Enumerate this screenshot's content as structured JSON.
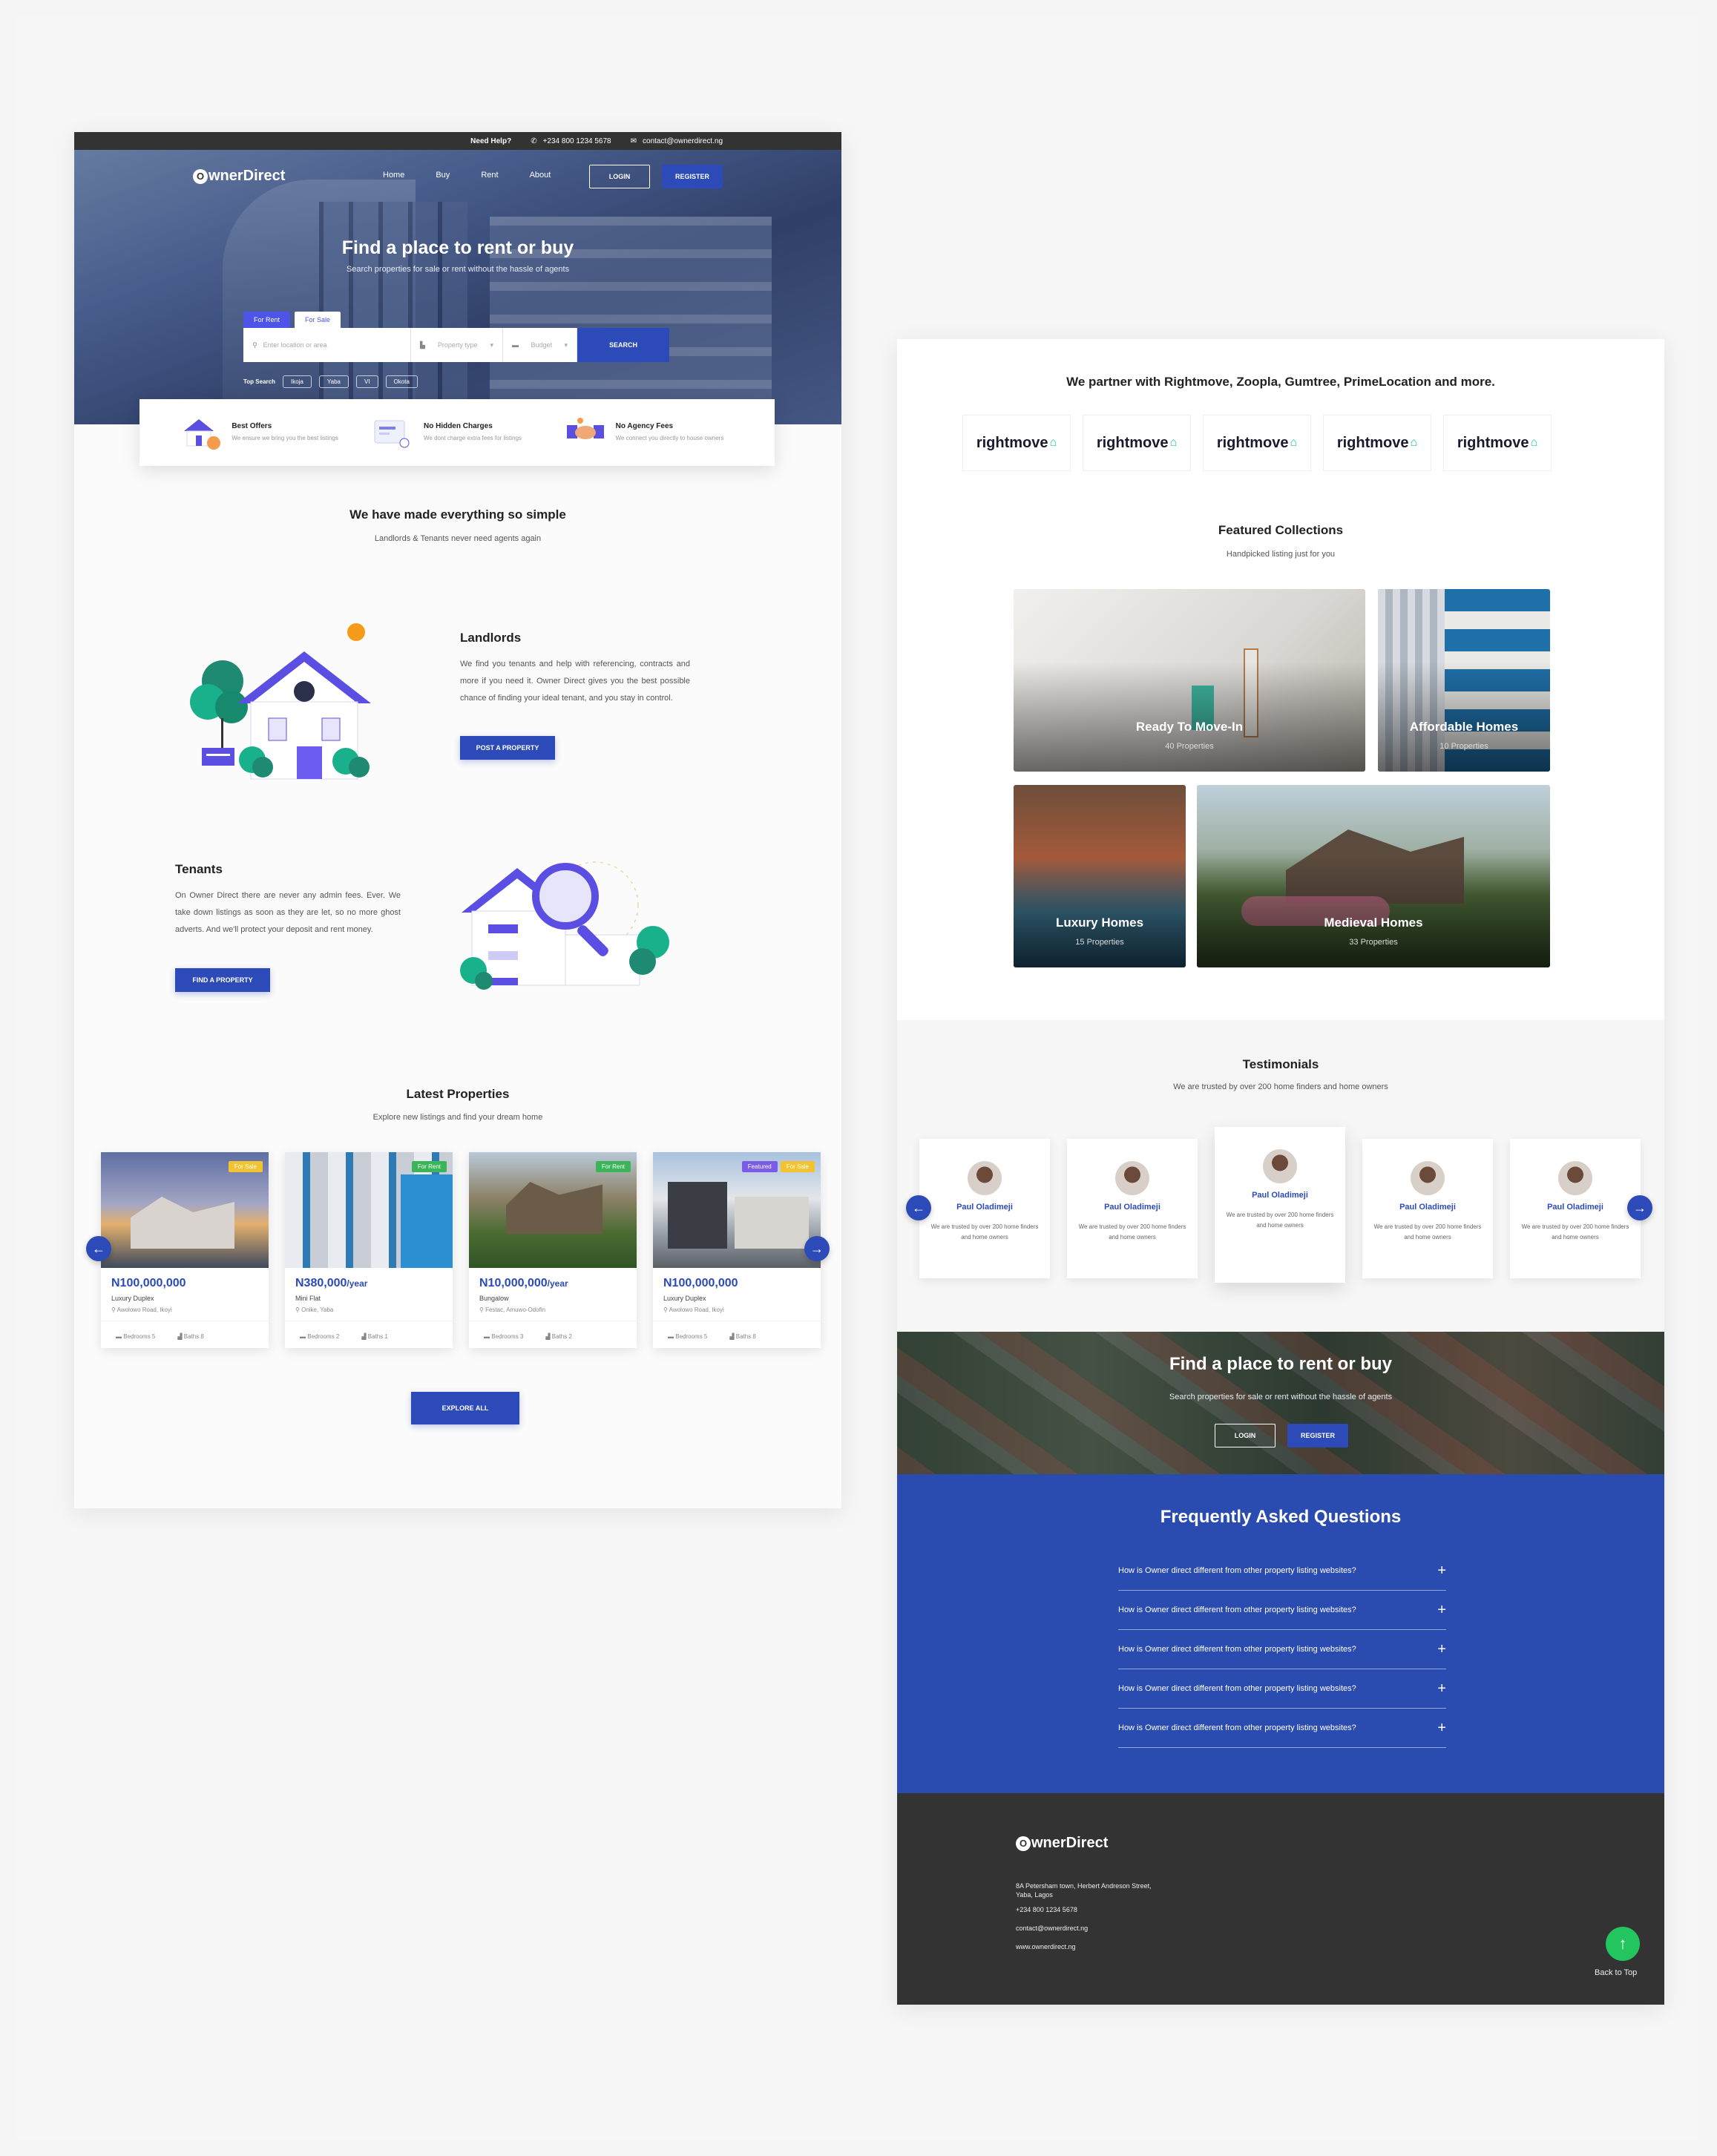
{
  "topbar": {
    "help": "Need Help?",
    "phone": "+234 800 1234 5678",
    "email": "contact@ownerdirect.ng"
  },
  "brand": {
    "logo_o": "O",
    "logo_rest": "wnerDirect"
  },
  "nav": {
    "links": [
      "Home",
      "Buy",
      "Rent",
      "About"
    ],
    "login": "LOGIN",
    "register": "REGISTER"
  },
  "hero": {
    "title": "Find a place to rent or buy",
    "subtitle": "Search properties for sale or rent without the hassle of agents",
    "tab_rent": "For Rent",
    "tab_sale": "For Sale",
    "location_placeholder": "Enter location or area",
    "type_placeholder": "Property type",
    "budget_placeholder": "Budget",
    "search": "SEARCH",
    "top_search": "Top Search",
    "top_chips": [
      "Ikoja",
      "Yaba",
      "VI",
      "Okota"
    ]
  },
  "features": [
    {
      "title": "Best Offers",
      "desc": "We ensure we bring you the best listings"
    },
    {
      "title": "No Hidden Charges",
      "desc": "We dont charge extra fees for listings"
    },
    {
      "title": "No Agency Fees",
      "desc": "We connect you directly to house owners"
    }
  ],
  "simple": {
    "title": "We have made everything so simple",
    "subtitle": "Landlords & Tenants never need agents again"
  },
  "landlords": {
    "title": "Landlords",
    "text": "We find you tenants and help with referencing, contracts and more if you need it. Owner Direct gives you the best possible chance of finding your ideal tenant, and you stay in control.",
    "button": "POST A PROPERTY"
  },
  "tenants": {
    "title": "Tenants",
    "text": "On Owner Direct there are never any admin fees. Ever. We take down listings as soon as they are let, so no more ghost adverts. And we'll protect your deposit and rent money.",
    "button": "FIND A PROPERTY"
  },
  "latest": {
    "title": "Latest Properties",
    "subtitle": "Explore new listings and find your dream home",
    "explore": "EXPLORE ALL",
    "cards": [
      {
        "price": "N100,000,000",
        "per": "",
        "type": "Luxury Duplex",
        "loc": "Awolowo Road, Ikoyi",
        "beds": "Bedrooms 5",
        "baths": "Baths 8",
        "badges": [
          "For Sale"
        ]
      },
      {
        "price": "N380,000",
        "per": "/year",
        "type": "Mini Flat",
        "loc": "Onike, Yaba",
        "beds": "Bedrooms 2",
        "baths": "Baths 1",
        "badges": [
          "For Rent"
        ]
      },
      {
        "price": "N10,000,000",
        "per": "/year",
        "type": "Bungalow",
        "loc": "Festac, Amuwo-Odofin",
        "beds": "Bedrooms 3",
        "baths": "Baths 2",
        "badges": [
          "For Rent"
        ]
      },
      {
        "price": "N100,000,000",
        "per": "",
        "type": "Luxury Duplex",
        "loc": "Awolowo Road, Ikoyi",
        "beds": "Bedrooms 5",
        "baths": "Baths 8",
        "badges": [
          "Featured",
          "For Sale"
        ]
      }
    ]
  },
  "colors": {
    "primary": "#2d4bb8",
    "accent": "#4c55e8",
    "for_sale": "#f2c230",
    "for_rent": "#3cb55a",
    "featured": "#7b5ce6",
    "dark": "#333333",
    "green": "#22c55e"
  },
  "partners": {
    "title": "We partner with Rightmove, Zoopla, Gumtree, PrimeLocation and more.",
    "logos": [
      "rightmove",
      "rightmove",
      "rightmove",
      "rightmove",
      "rightmove"
    ]
  },
  "featured": {
    "title": "Featured Collections",
    "subtitle": "Handpicked listing just for you",
    "items": [
      {
        "name": "Ready To Move-In",
        "count": "40 Properties"
      },
      {
        "name": "Affordable Homes",
        "count": "10 Properties"
      },
      {
        "name": "Luxury Homes",
        "count": "15 Properties"
      },
      {
        "name": "Medieval Homes",
        "count": "33 Properties"
      }
    ]
  },
  "testimonials": {
    "title": "Testimonials",
    "subtitle": "We are trusted by over 200 home finders and home owners",
    "items": [
      {
        "name": "Paul Oladimeji",
        "text": "We are trusted by over 200 home finders and home owners"
      },
      {
        "name": "Paul Oladimeji",
        "text": "We are trusted by over 200 home finders and home owners"
      },
      {
        "name": "Paul Oladimeji",
        "text": "We are trusted by over 200 home finders and home owners"
      },
      {
        "name": "Paul Oladimeji",
        "text": "We are trusted by over 200 home finders and home owners"
      },
      {
        "name": "Paul Oladimeji",
        "text": "We are trusted by over 200 home finders and home owners"
      }
    ]
  },
  "cta": {
    "title": "Find a place to rent or buy",
    "subtitle": "Search properties for sale or rent without the hassle of agents",
    "login": "LOGIN",
    "register": "REGISTER"
  },
  "faq": {
    "title": "Frequently Asked Questions",
    "items": [
      "How is Owner direct different from other property listing websites?",
      "How is Owner direct different from other property listing websites?",
      "How is Owner direct different from other property listing websites?",
      "How is Owner direct different from other property listing websites?",
      "How is Owner direct different from other property listing websites?"
    ]
  },
  "footer": {
    "address1": "8A Petersham town, Herbert Andreson Street,",
    "address2": "Yaba, Lagos",
    "phone": "+234 800 1234 5678",
    "email": "contact@ownerdirect.ng",
    "web": "www.ownerdirect.ng",
    "back_to_top": "Back to Top"
  }
}
